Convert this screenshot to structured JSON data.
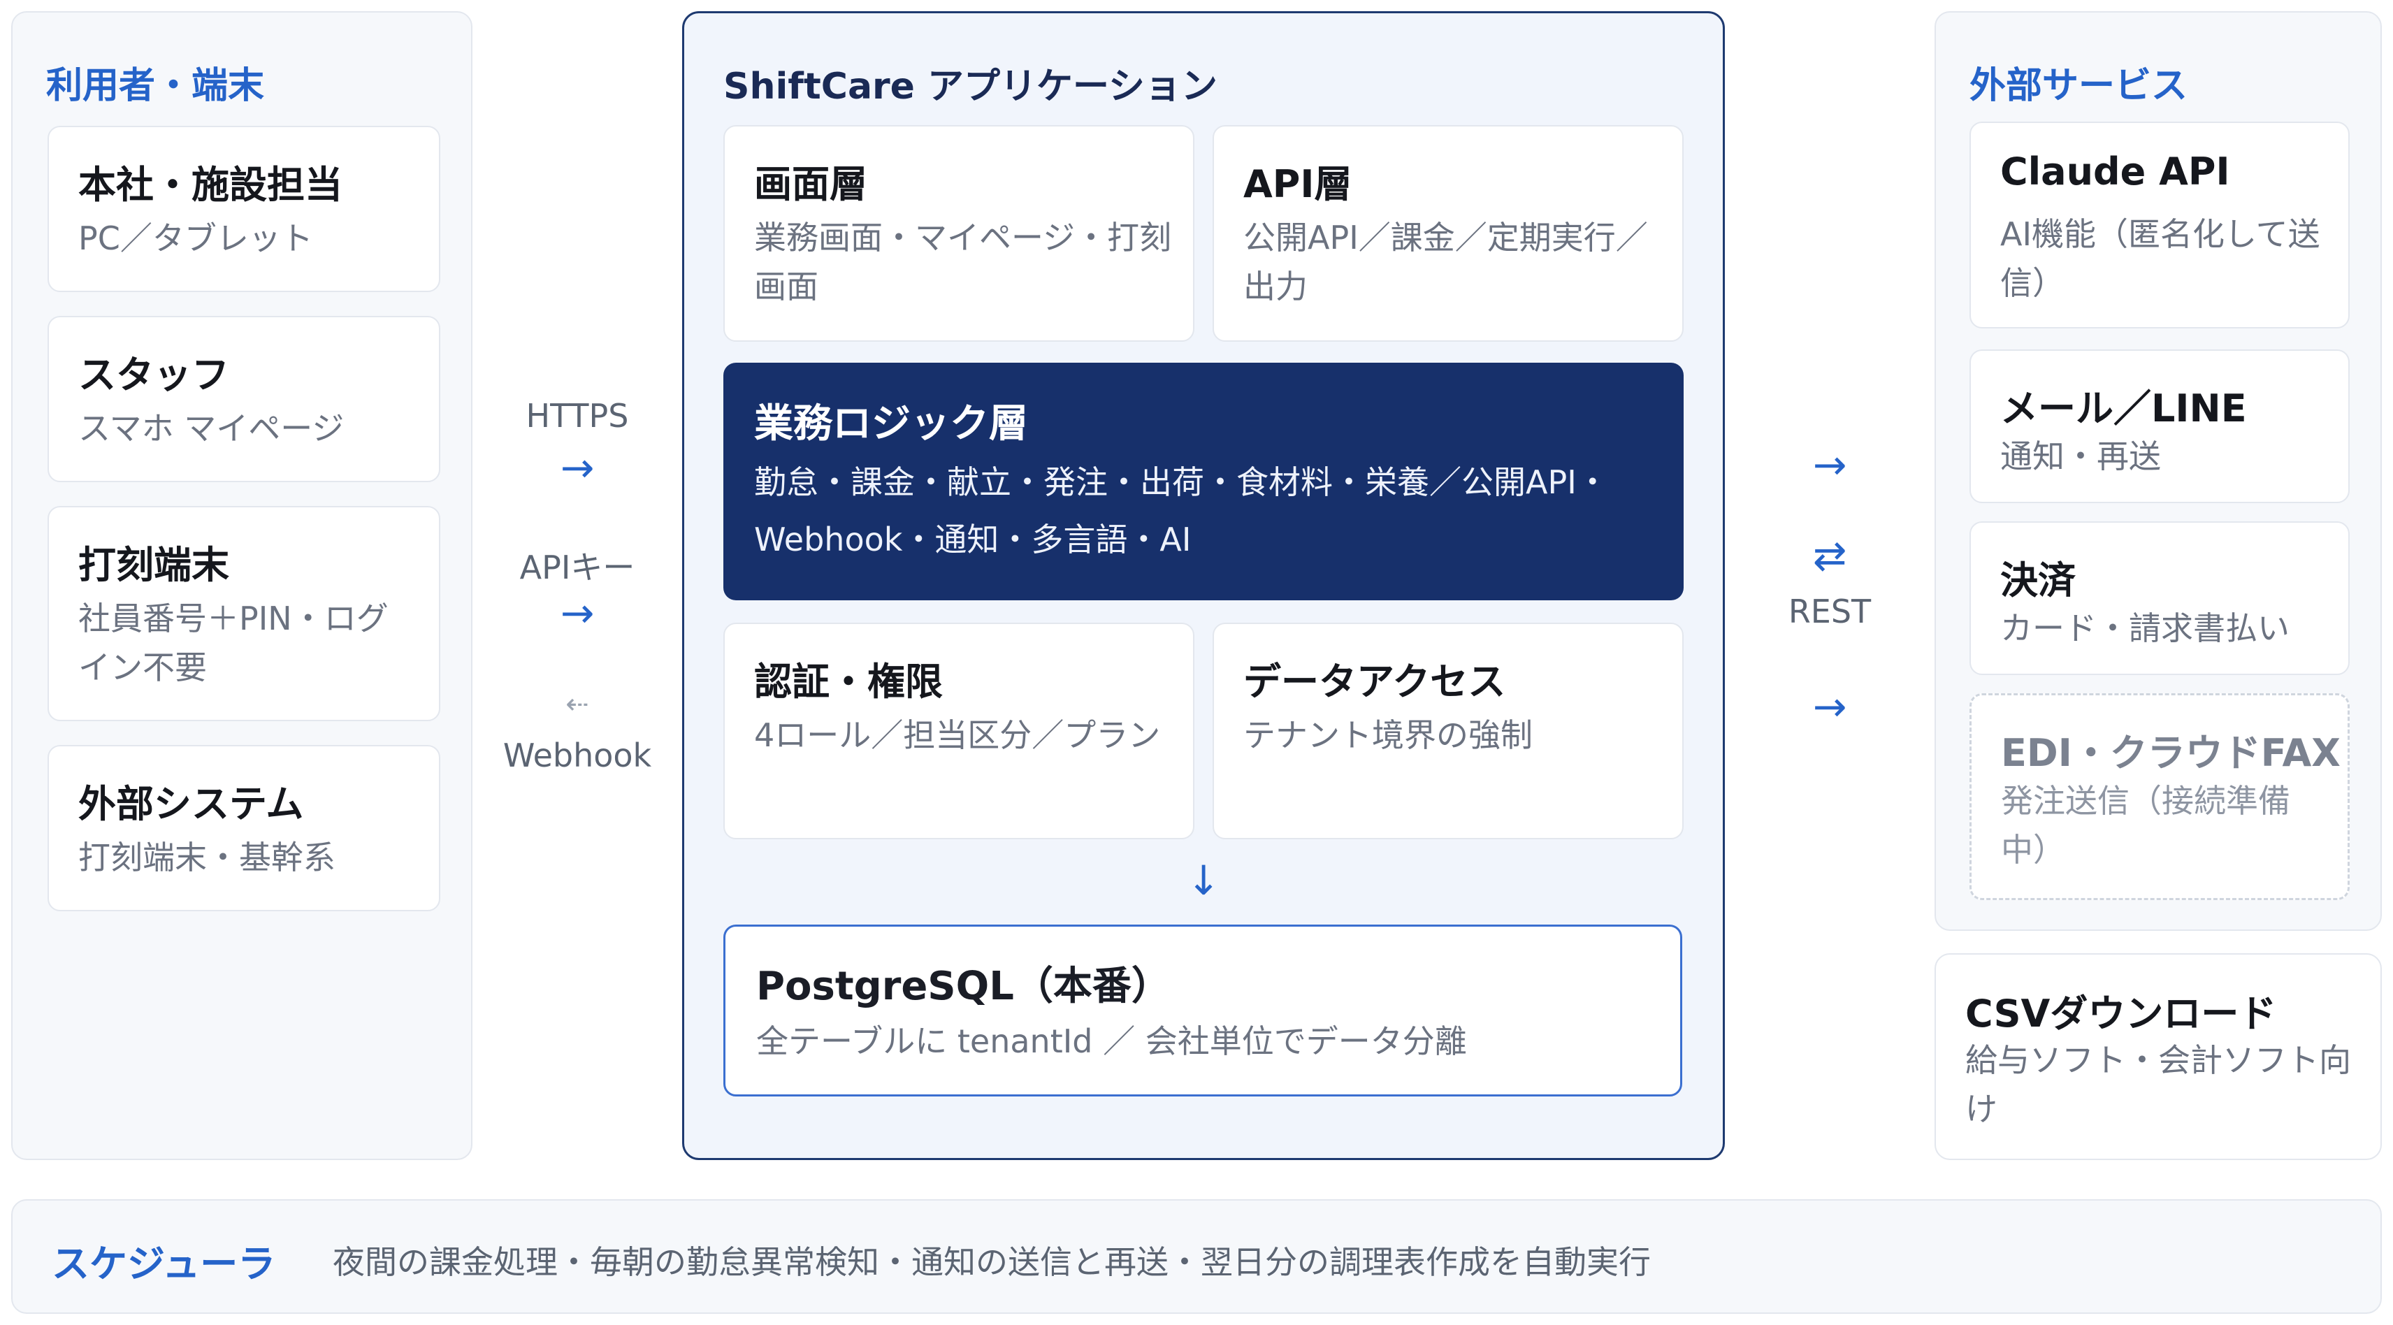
{
  "users": {
    "title": "利用者・端末",
    "cards": [
      {
        "title": "本社・施設担当",
        "desc": "PC／タブレット"
      },
      {
        "title": "スタッフ",
        "desc": "スマホ マイページ"
      },
      {
        "title": "打刻端末",
        "desc": "社員番号＋PIN・ログイン不要"
      },
      {
        "title": "外部システム",
        "desc": "打刻端末・基幹系"
      }
    ]
  },
  "left_connector": {
    "https_label": "HTTPS",
    "https_arrow": "→",
    "apikey_label": "APIキー",
    "apikey_arrow": "→",
    "webhook_arrow": "⇠",
    "webhook_label": "Webhook"
  },
  "app": {
    "title": "ShiftCare アプリケーション",
    "screen_layer": {
      "title": "画面層",
      "desc": "業務画面・マイページ・打刻画面"
    },
    "api_layer": {
      "title": "API層",
      "desc": "公開API／課金／定期実行／出力"
    },
    "logic_layer": {
      "title": "業務ロジック層",
      "desc": "勤怠・課金・献立・発注・出荷・食材料・栄養／公開API・Webhook・通知・多言語・AI"
    },
    "auth": {
      "title": "認証・権限",
      "desc": "4ロール／担当区分／プラン"
    },
    "data_access": {
      "title": "データアクセス",
      "desc": "テナント境界の強制"
    },
    "down_arrow": "↓",
    "db": {
      "title": "PostgreSQL（本番）",
      "desc": "全テーブルに tenantId ／ 会社単位でデータ分離"
    }
  },
  "right_connector": {
    "arrow1": "→",
    "arrow2": "⇄",
    "rest_label": "REST",
    "arrow3": "→"
  },
  "external": {
    "title": "外部サービス",
    "cards": [
      {
        "title": "Claude API",
        "desc": "AI機能（匿名化して送信）"
      },
      {
        "title": "メール／LINE",
        "desc": "通知・再送"
      },
      {
        "title": "決済",
        "desc": "カード・請求書払い"
      },
      {
        "title": "EDI・クラウドFAX",
        "desc": "発注送信（接続準備中）",
        "status": "pending"
      }
    ]
  },
  "csv": {
    "title": "CSVダウンロード",
    "desc": "給与ソフト・会計ソフト向け"
  },
  "scheduler": {
    "title": "スケジューラ",
    "desc": "夜間の課金処理・毎朝の勤怠異常検知・通知の送信と再送・翌日分の調理表作成を自動実行"
  }
}
